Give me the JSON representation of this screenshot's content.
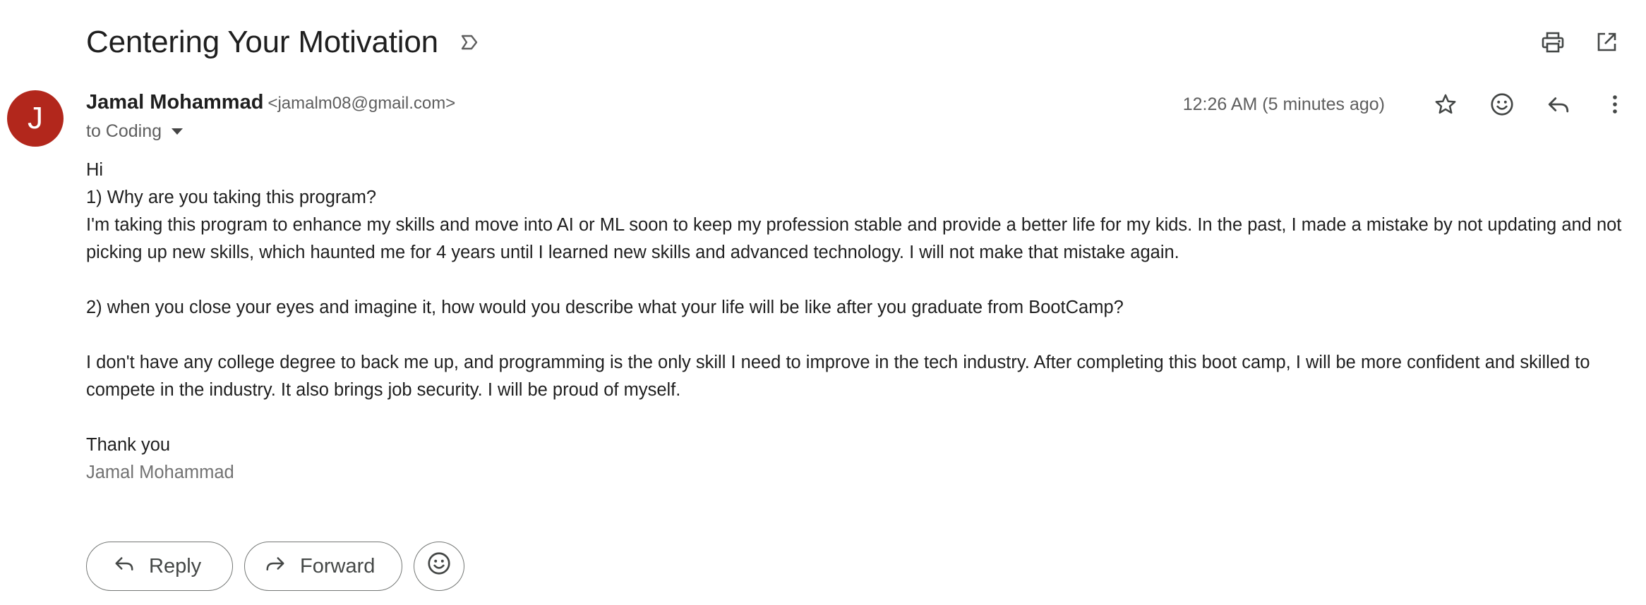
{
  "email": {
    "subject": "Centering Your Motivation",
    "sender_name": "Jamal Mohammad",
    "sender_email": "<jamalm08@gmail.com>",
    "avatar_initial": "J",
    "to": "to Coding",
    "timestamp": "12:26 AM (5 minutes ago)",
    "body": {
      "greeting": "Hi",
      "q1": "1) Why are you taking this program?",
      "a1": "I'm taking this program to enhance my skills and move into AI or ML soon to keep my profession stable and provide a better life for my kids. In the past, I made a mistake by not updating and not picking up new skills, which haunted me for 4 years until I learned new skills and advanced technology. I will not make that mistake again.",
      "q2": "2) when you close your eyes and imagine it, how would you describe what your life will be like after you graduate from BootCamp?",
      "a2": "I don't have any college degree to back me up, and programming is the only skill I need to improve in the tech industry. After completing this boot camp, I will be more confident and skilled to compete in the industry. It also brings job security. I will be proud of myself.",
      "closing": "Thank you",
      "signature": "Jamal Mohammad"
    }
  },
  "actions": {
    "reply_label": "Reply",
    "forward_label": "Forward"
  },
  "icons": {
    "label": "label-outline-icon",
    "print": "print-icon",
    "open_new": "open-in-new-icon",
    "star": "star-icon",
    "emoji": "emoji-smile-icon",
    "reply": "reply-icon",
    "more": "more-vert-icon",
    "forward": "forward-icon"
  },
  "colors": {
    "avatar_bg": "#b2271c",
    "text": "#1f1f1f",
    "secondary_text": "#5e5e5e",
    "icon": "#444746"
  }
}
